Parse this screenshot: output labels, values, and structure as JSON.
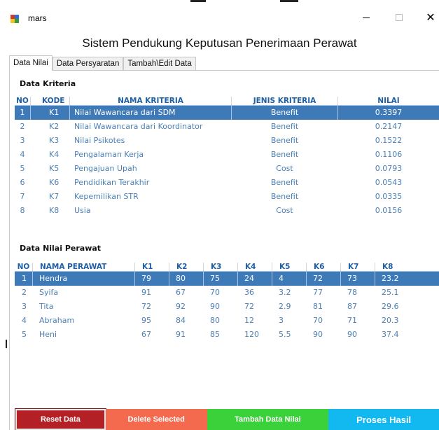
{
  "window": {
    "title": "mars",
    "minimize_icon": "minimize-icon",
    "maximize_icon": "maximize-icon",
    "close_icon": "close-icon",
    "close_glyph": "✕"
  },
  "main": {
    "title": "Sistem Pendukung Keputusan Penerimaan Perawat"
  },
  "tabs": [
    {
      "label": "Data Nilai",
      "active": true
    },
    {
      "label": "Data Persyaratan",
      "active": false
    },
    {
      "label": "Tambah\\Edit Data",
      "active": false
    }
  ],
  "kriteria": {
    "section_title": "Data Kriteria",
    "headers": [
      "NO",
      "KODE",
      "NAMA KRITERIA",
      "JENIS KRITERIA",
      "NILAI"
    ],
    "rows": [
      {
        "no": "1",
        "kode": "K1",
        "nama": "Nilai Wawancara dari SDM",
        "jenis": "Benefit",
        "nilai": "0.3397",
        "selected": true
      },
      {
        "no": "2",
        "kode": "K2",
        "nama": "Nilai Wawancara dari Koordinator",
        "jenis": "Benefit",
        "nilai": "0.2147",
        "selected": false
      },
      {
        "no": "3",
        "kode": "K3",
        "nama": "Nilai Psikotes",
        "jenis": "Benefit",
        "nilai": "0.1522",
        "selected": false
      },
      {
        "no": "4",
        "kode": "K4",
        "nama": "Pengalaman Kerja",
        "jenis": "Benefit",
        "nilai": "0.1106",
        "selected": false
      },
      {
        "no": "5",
        "kode": "K5",
        "nama": "Pengajuan Upah",
        "jenis": "Cost",
        "nilai": "0.0793",
        "selected": false
      },
      {
        "no": "6",
        "kode": "K6",
        "nama": "Pendidikan Terakhir",
        "jenis": "Benefit",
        "nilai": "0.0543",
        "selected": false
      },
      {
        "no": "7",
        "kode": "K7",
        "nama": "Kepemilikan STR",
        "jenis": "Benefit",
        "nilai": "0.0335",
        "selected": false
      },
      {
        "no": "8",
        "kode": "K8",
        "nama": "Usia",
        "jenis": "Cost",
        "nilai": "0.0156",
        "selected": false
      }
    ]
  },
  "perawat": {
    "section_title": "Data Nilai Perawat",
    "headers": [
      "NO",
      "NAMA PERAWAT",
      "K1",
      "K2",
      "K3",
      "K4",
      "K5",
      "K6",
      "K7",
      "K8"
    ],
    "rows": [
      {
        "cells": [
          "1",
          "Hendra",
          "79",
          "80",
          "75",
          "24",
          "4",
          "72",
          "73",
          "23.2"
        ],
        "selected": true
      },
      {
        "cells": [
          "2",
          "Syifa",
          "91",
          "67",
          "70",
          "36",
          "3.2",
          "77",
          "78",
          "25.1"
        ],
        "selected": false
      },
      {
        "cells": [
          "3",
          "Tita",
          "72",
          "92",
          "90",
          "72",
          "2.9",
          "81",
          "87",
          "29.6"
        ],
        "selected": false
      },
      {
        "cells": [
          "4",
          "Abraham",
          "95",
          "84",
          "80",
          "12",
          "3",
          "70",
          "71",
          "20.3"
        ],
        "selected": false
      },
      {
        "cells": [
          "5",
          "Heni",
          "67",
          "91",
          "85",
          "120",
          "5.5",
          "90",
          "90",
          "37.4"
        ],
        "selected": false
      }
    ]
  },
  "buttons": {
    "reset": "Reset Data",
    "delete": "Delete Selected",
    "tambah": "Tambah Data Nilai",
    "proses": "Proses Hasil"
  },
  "colors": {
    "selected_row": "#3f7ab8",
    "header_text": "#1f5fa6",
    "row_text": "#4a7fb5",
    "reset": "#b32025",
    "delete": "#f36a4f",
    "tambah": "#3bd13b",
    "proses": "#12b8f0"
  }
}
